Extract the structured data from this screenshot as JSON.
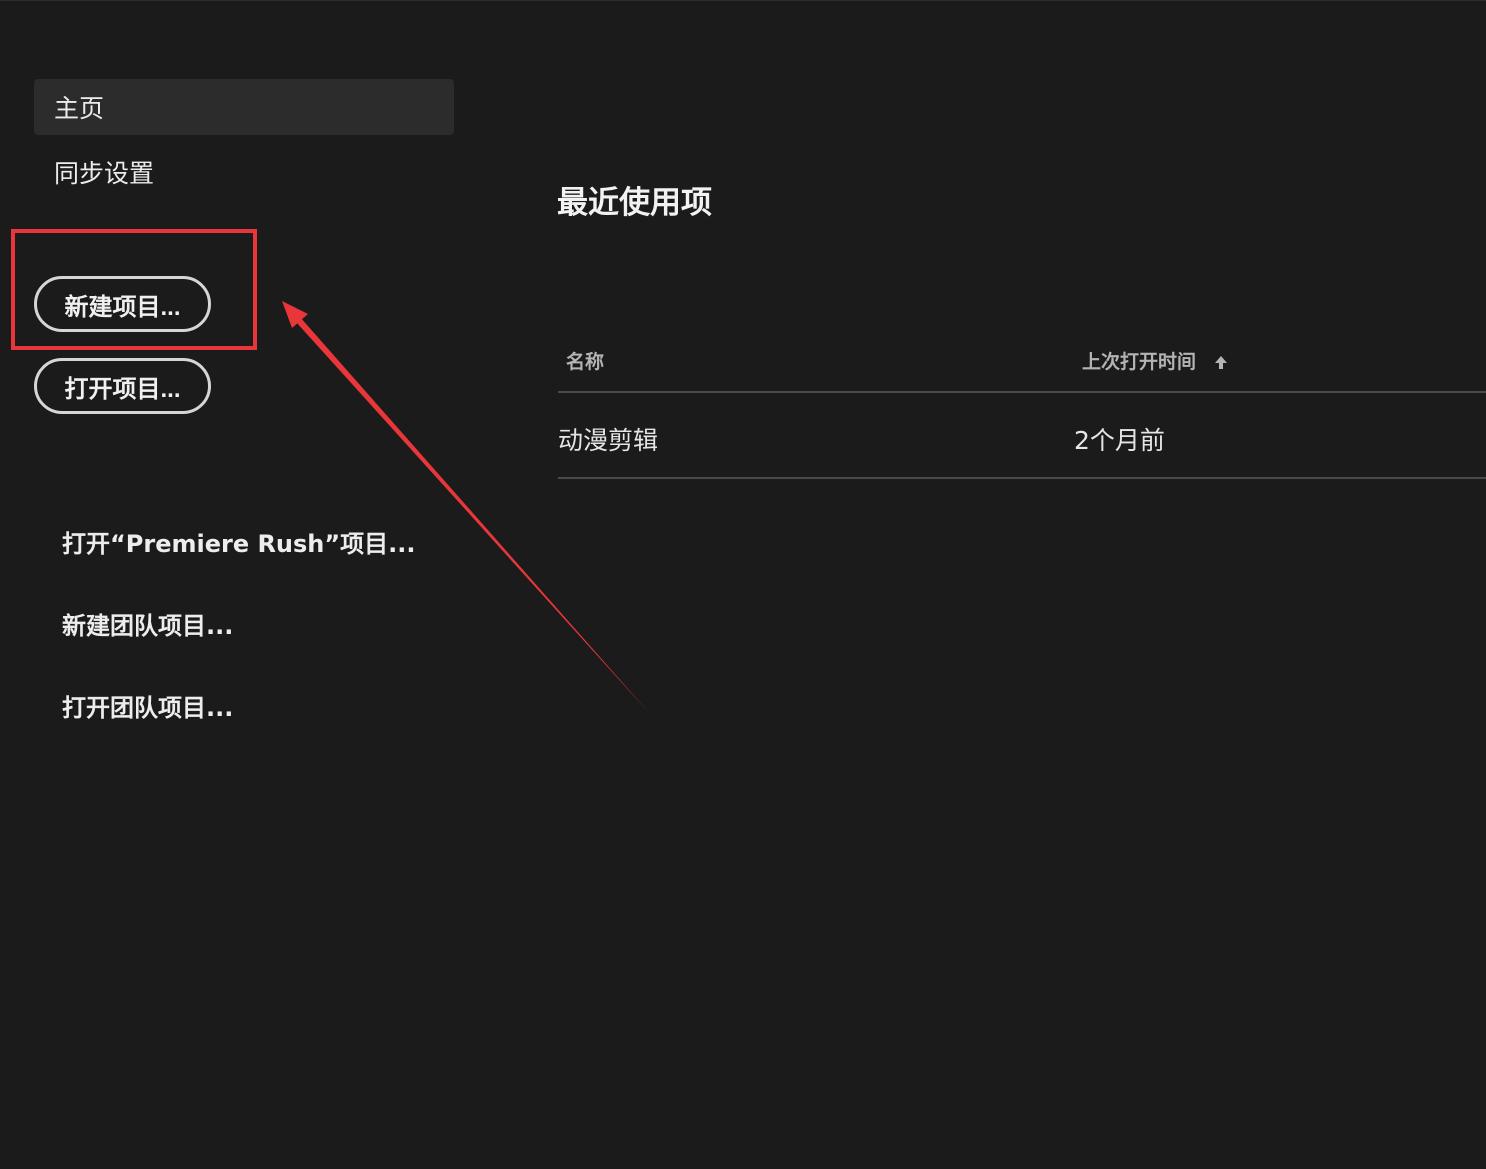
{
  "sidebar": {
    "nav": [
      {
        "label": "主页",
        "active": true
      },
      {
        "label": "同步设置",
        "active": false
      }
    ],
    "buttons": {
      "new_project": "新建项目...",
      "open_project": "打开项目..."
    },
    "links": {
      "open_rush": "打开“Premiere Rush”项目...",
      "new_team": "新建团队项目...",
      "open_team": "打开团队项目..."
    }
  },
  "main": {
    "title": "最近使用项",
    "table": {
      "columns": {
        "name": "名称",
        "last_opened": "上次打开时间"
      },
      "sort_icon": "arrow-up-icon",
      "rows": [
        {
          "name": "动漫剪辑",
          "last_opened": "2个月前"
        }
      ]
    }
  },
  "colors": {
    "background": "#1b1b1b",
    "active_nav": "#2c2c2c",
    "annotation": "#e8363a"
  }
}
